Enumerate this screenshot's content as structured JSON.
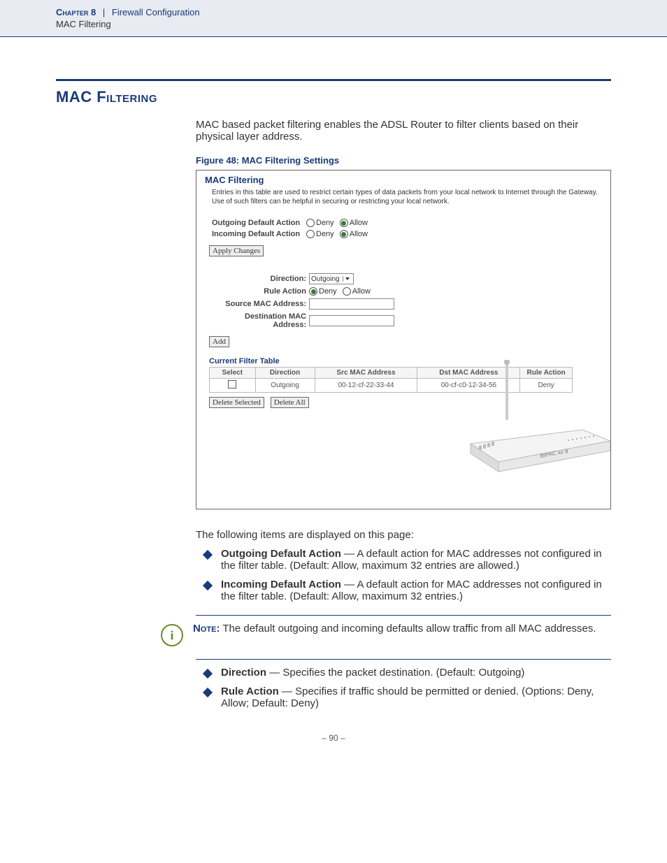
{
  "header": {
    "chapter": "Chapter 8",
    "separator": "|",
    "section": "Firewall Configuration",
    "subsection": "MAC Filtering"
  },
  "title": "MAC Filtering",
  "intro": "MAC based packet filtering enables the ADSL Router to filter clients based on their physical layer address.",
  "figure": {
    "caption": "Figure 48:  MAC Filtering Settings",
    "panel_title": "MAC Filtering",
    "panel_desc": "Entries in this table are used to restrict certain types of data packets from your local network to Internet through the Gateway. Use of such filters can be helpful in securing or restricting your local network.",
    "outgoing_label": "Outgoing Default Action",
    "incoming_label": "Incoming Default Action",
    "deny": "Deny",
    "allow": "Allow",
    "apply_changes": "Apply Changes",
    "direction_label": "Direction:",
    "direction_value": "Outgoing",
    "rule_action_label": "Rule Action",
    "src_mac_label": "Source MAC Address:",
    "dst_mac_label": "Destination MAC Address:",
    "add_btn": "Add",
    "table_title": "Current Filter Table",
    "cols": {
      "select": "Select",
      "direction": "Direction",
      "src": "Src MAC Address",
      "dst": "Dst MAC Address",
      "action": "Rule Action"
    },
    "row": {
      "direction": "Outgoing",
      "src": "00-12-cf-22-33-44",
      "dst": "00-cf-c0-12-34-56",
      "action": "Deny"
    },
    "delete_selected": "Delete Selected",
    "delete_all": "Delete All"
  },
  "after_figure": "The following items are displayed on this page:",
  "items1": [
    {
      "term": "Outgoing Default Action",
      "desc": " — A default action for MAC addresses not configured in the filter table. (Default: Allow, maximum 32 entries are allowed.)"
    },
    {
      "term": "Incoming Default Action",
      "desc": " — A default action for MAC addresses not configured in the filter table. (Default: Allow, maximum 32 entries.)"
    }
  ],
  "note": {
    "label": "Note:",
    "text": " The default outgoing and incoming defaults allow traffic from all MAC addresses."
  },
  "items2": [
    {
      "term": "Direction",
      "desc": " — Specifies the packet destination. (Default: Outgoing)"
    },
    {
      "term": "Rule Action",
      "desc": " — Specifies if traffic should be permitted or denied. (Options: Deny, Allow; Default: Deny)"
    }
  ],
  "page_number": "–  90  –"
}
